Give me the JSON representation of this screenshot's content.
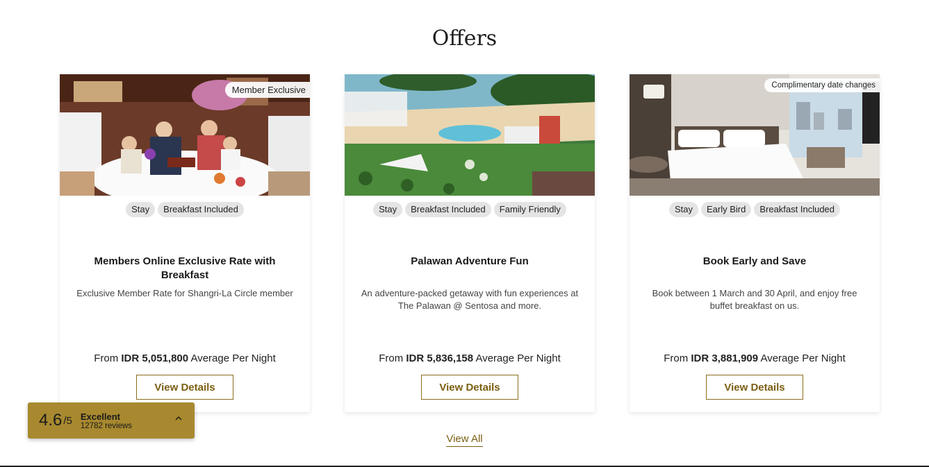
{
  "section": {
    "title": "Offers"
  },
  "offers": [
    {
      "ribbon": "Member Exclusive",
      "tags": [
        "Stay",
        "Breakfast Included"
      ],
      "title": "Members Online Exclusive Rate with Breakfast",
      "description": "Exclusive Member Rate for Shangri-La Circle member",
      "price_prefix": "From",
      "price": "IDR 5,051,800",
      "price_suffix": "Average Per Night",
      "button": "View Details"
    },
    {
      "ribbon": "",
      "tags": [
        "Stay",
        "Breakfast Included",
        "Family Friendly"
      ],
      "title": "Palawan Adventure Fun",
      "description": "An adventure-packed getaway with fun experiences at The Palawan @ Sentosa and more.",
      "price_prefix": "From",
      "price": "IDR 5,836,158",
      "price_suffix": "Average Per Night",
      "button": "View Details"
    },
    {
      "ribbon": "Complimentary date changes",
      "tags": [
        "Stay",
        "Early Bird",
        "Breakfast Included"
      ],
      "title": "Book Early and Save",
      "description": "Book between 1 March and 30 April, and enjoy free buffet breakfast on us.",
      "price_prefix": "From",
      "price": "IDR 3,881,909",
      "price_suffix": "Average Per Night",
      "button": "View Details"
    }
  ],
  "view_all": "View All",
  "rating": {
    "score": "4.6",
    "max": "/5",
    "label": "Excellent",
    "count": "12782 reviews"
  },
  "colors": {
    "accent": "#7a5e12",
    "rating_bg": "#a8892f",
    "tag_bg": "#e4e4e4"
  }
}
